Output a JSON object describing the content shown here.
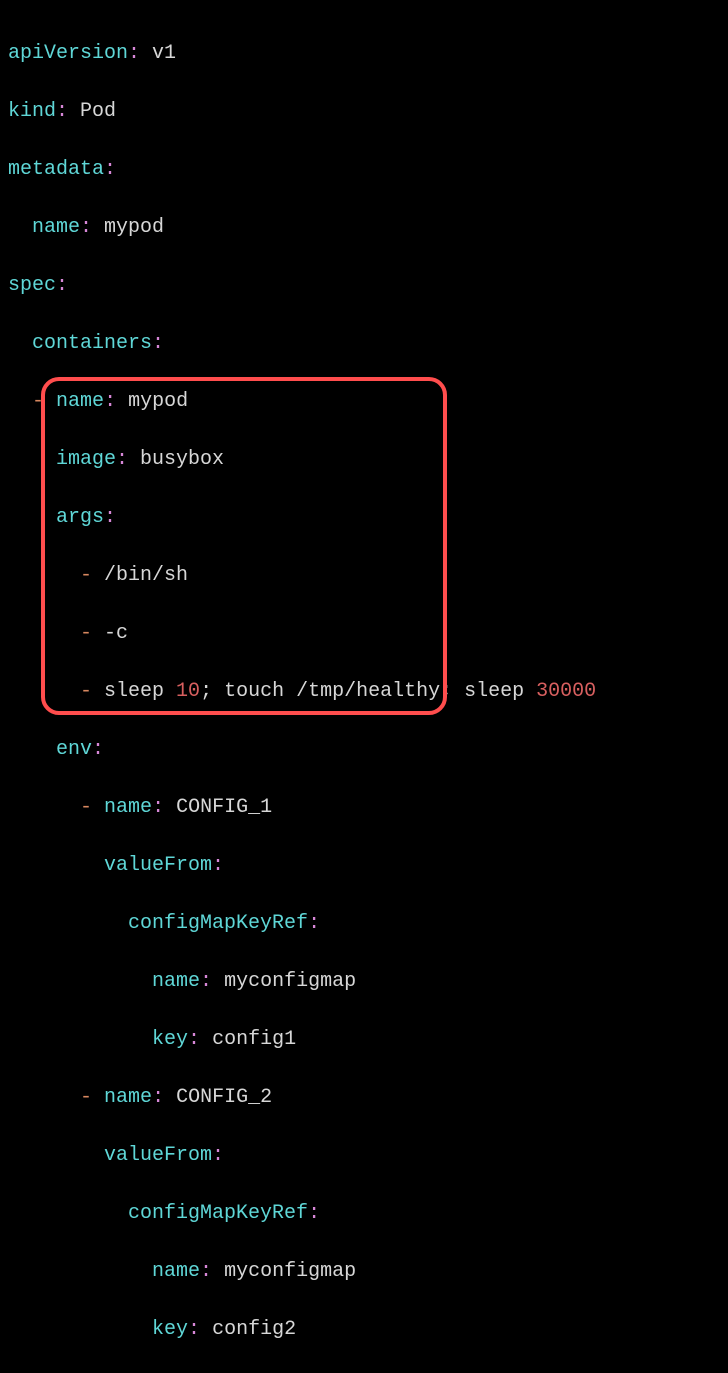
{
  "yaml": {
    "line1": {
      "k1": "apiVersion",
      "c1": ":",
      "v1": " v1"
    },
    "line2": {
      "k1": "kind",
      "c1": ":",
      "v1": " Pod"
    },
    "line3": {
      "k1": "metadata",
      "c1": ":"
    },
    "line4": {
      "indent": "  ",
      "k1": "name",
      "c1": ":",
      "v1": " mypod"
    },
    "line5": {
      "k1": "spec",
      "c1": ":"
    },
    "line6": {
      "indent": "  ",
      "k1": "containers",
      "c1": ":"
    },
    "line7": {
      "indent": "  ",
      "d": "-",
      "sp": " ",
      "k1": "name",
      "c1": ":",
      "v1": " mypod"
    },
    "line8": {
      "indent": "    ",
      "k1": "image",
      "c1": ":",
      "v1": " busybox"
    },
    "line9": {
      "indent": "    ",
      "k1": "args",
      "c1": ":"
    },
    "line10": {
      "indent": "      ",
      "d": "-",
      "v1": " /bin/sh"
    },
    "line11": {
      "indent": "      ",
      "d": "-",
      "v1": " -c"
    },
    "line12": {
      "indent": "      ",
      "d": "-",
      "v1": " sleep ",
      "n1": "10",
      "v2": "; touch /tmp/healthy; sleep ",
      "n2": "30000"
    },
    "line13": {
      "indent": "    ",
      "k1": "env",
      "c1": ":"
    },
    "line14": {
      "indent": "      ",
      "d": "-",
      "sp": " ",
      "k1": "name",
      "c1": ":",
      "v1": " CONFIG_1"
    },
    "line15": {
      "indent": "        ",
      "k1": "valueFrom",
      "c1": ":"
    },
    "line16": {
      "indent": "          ",
      "k1": "configMapKeyRef",
      "c1": ":"
    },
    "line17": {
      "indent": "            ",
      "k1": "name",
      "c1": ":",
      "v1": " myconfigmap"
    },
    "line18": {
      "indent": "            ",
      "k1": "key",
      "c1": ":",
      "v1": " config1"
    },
    "line19": {
      "indent": "      ",
      "d": "-",
      "sp": " ",
      "k1": "name",
      "c1": ":",
      "v1": " CONFIG_2"
    },
    "line20": {
      "indent": "        ",
      "k1": "valueFrom",
      "c1": ":"
    },
    "line21": {
      "indent": "          ",
      "k1": "configMapKeyRef",
      "c1": ":"
    },
    "line22": {
      "indent": "            ",
      "k1": "name",
      "c1": ":",
      "v1": " myconfigmap"
    },
    "line23": {
      "indent": "            ",
      "k1": "key",
      "c1": ":",
      "v1": " config2"
    }
  }
}
